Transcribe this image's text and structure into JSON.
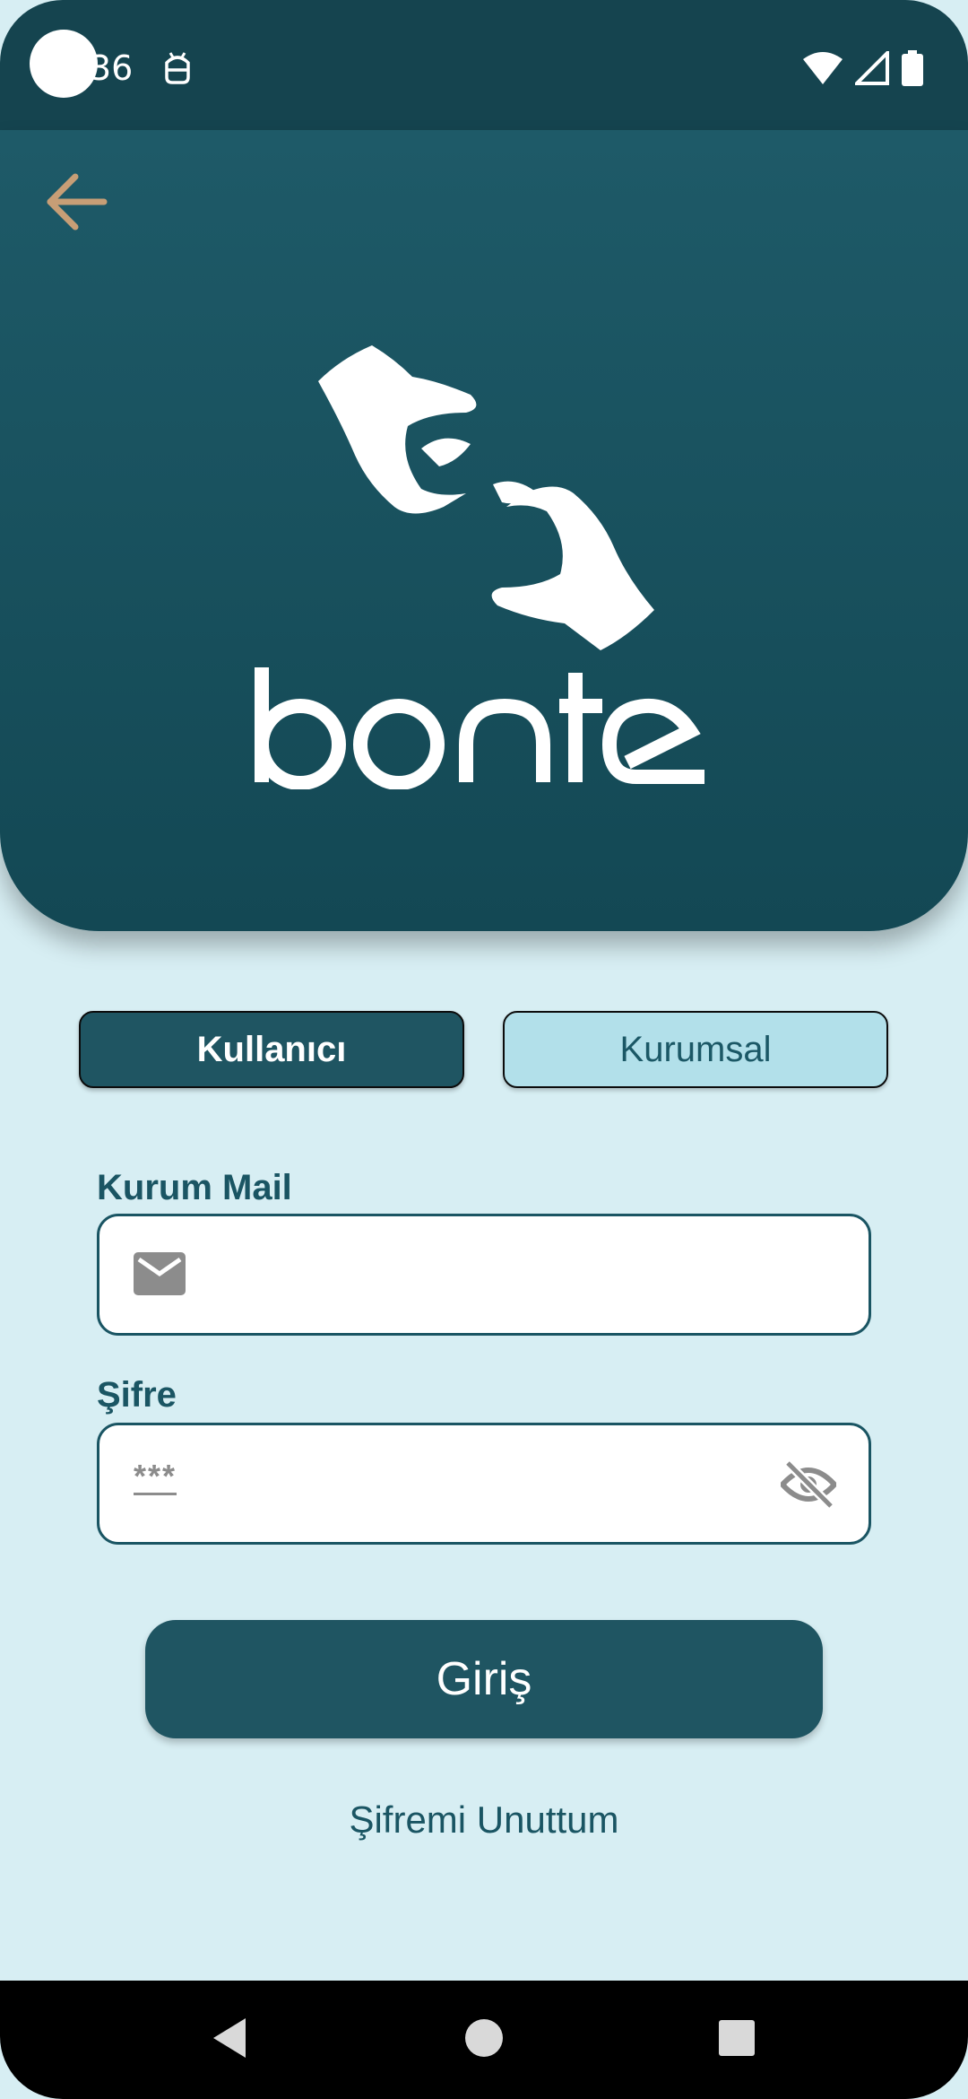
{
  "status_bar": {
    "time": "36",
    "icons": [
      "android-debug-icon",
      "wifi-icon",
      "signal-icon",
      "battery-icon"
    ]
  },
  "header": {
    "back_icon": "arrow-left-icon",
    "logo_text": "bonte",
    "colors": {
      "background": "#1e5a68",
      "back_arrow": "#c79e76"
    }
  },
  "tabs": {
    "user_label": "Kullanıcı",
    "corporate_label": "Kurumsal",
    "selected": "Kullanıcı"
  },
  "form": {
    "email_label": "Kurum Mail",
    "email_value": "",
    "email_icon": "mail-icon",
    "password_label": "Şifre",
    "password_mask": "***",
    "password_toggle_icon": "eye-off-icon"
  },
  "actions": {
    "login_label": "Giriş",
    "forgot_label": "Şifremi Unuttum"
  },
  "nav": {
    "icons": [
      "back-triangle-icon",
      "home-circle-icon",
      "recents-square-icon"
    ]
  }
}
